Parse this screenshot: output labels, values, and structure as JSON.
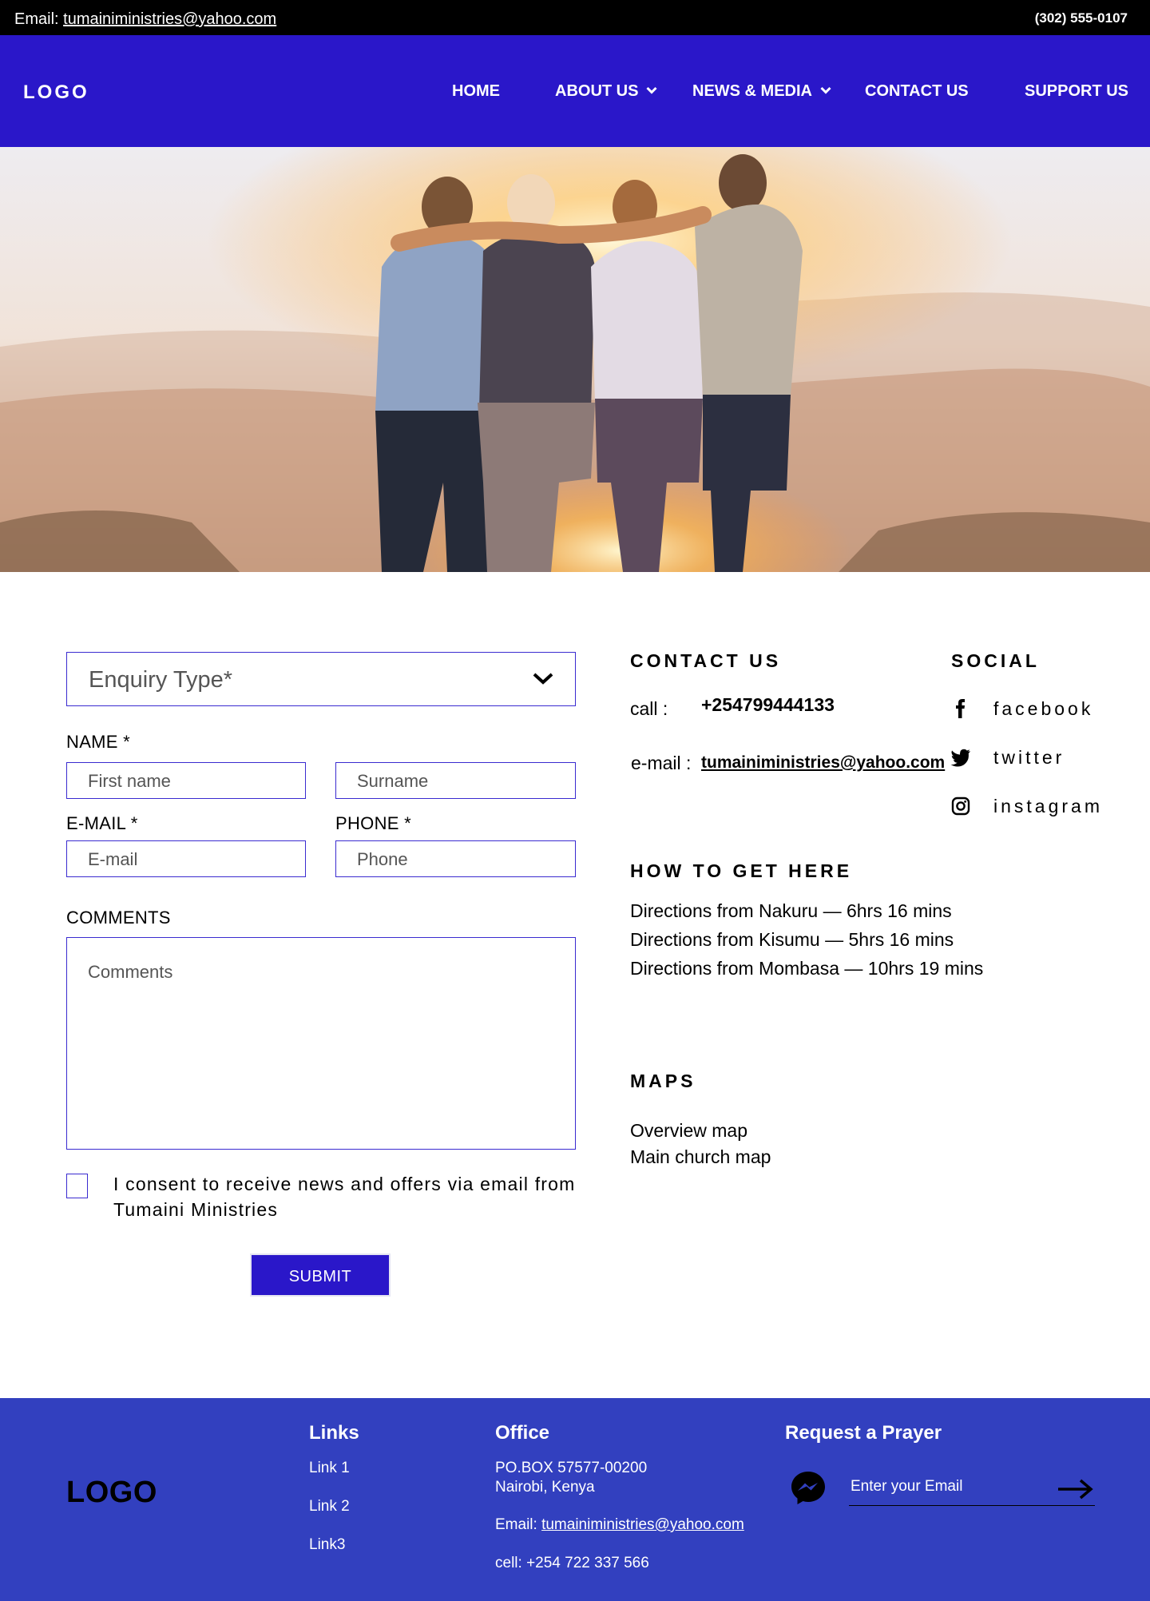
{
  "topbar": {
    "email_label": "Email:",
    "email": "tumainiministries@yahoo.com",
    "phone": "(302) 555-0107"
  },
  "nav": {
    "logo": "LOGO",
    "items": [
      {
        "label": "HOME"
      },
      {
        "label": "ABOUT US"
      },
      {
        "label": "NEWS & MEDIA"
      },
      {
        "label": "CONTACT US"
      },
      {
        "label": "SUPPORT US"
      }
    ]
  },
  "form": {
    "enquiry_placeholder": "Enquiry Type*",
    "name_label": "NAME *",
    "first_name_placeholder": "First name",
    "surname_placeholder": "Surname",
    "email_label": "E-MAIL *",
    "email_placeholder": "E-mail",
    "phone_label": "PHONE *",
    "phone_placeholder": "Phone",
    "comments_label": "COMMENTS",
    "comments_placeholder": "Comments",
    "consent_text": "I consent to receive news and offers via email from Tumaini Ministries",
    "submit_label": "SUBMIT"
  },
  "contact": {
    "heading": "CONTACT US",
    "call_label": "call :",
    "call_value": "+254799444133",
    "email_label": "e-mail :",
    "email_value": "tumainiministries@yahoo.com"
  },
  "social": {
    "heading": "SOCIAL",
    "items": [
      {
        "name": "facebook",
        "icon": "facebook-icon"
      },
      {
        "name": "twitter",
        "icon": "twitter-icon"
      },
      {
        "name": "instagram",
        "icon": "instagram-icon"
      }
    ]
  },
  "directions": {
    "heading": "HOW TO GET HERE",
    "items": [
      "Directions from Nakuru — 6hrs 16 mins",
      "Directions from Kisumu — 5hrs 16 mins",
      "Directions from Mombasa — 10hrs 19 mins"
    ]
  },
  "maps": {
    "heading": "MAPS",
    "items": [
      "Overview map",
      "Main church map"
    ]
  },
  "footer": {
    "logo": "LOGO",
    "links_heading": "Links",
    "links": [
      "Link 1",
      "Link 2",
      "Link3"
    ],
    "office_heading": "Office",
    "address_line1": "PO.BOX 57577-00200",
    "address_line2": "Nairobi, Kenya",
    "email_label": "Email:",
    "email": "tumainiministries@yahoo.com",
    "cell": "cell: +254 722 337 566",
    "prayer_heading": "Request a Prayer",
    "prayer_placeholder": "Enter your Email"
  },
  "colors": {
    "brand_blue": "#2a17c9",
    "footer_blue": "#3240bf",
    "input_border": "#3a2bd0"
  }
}
